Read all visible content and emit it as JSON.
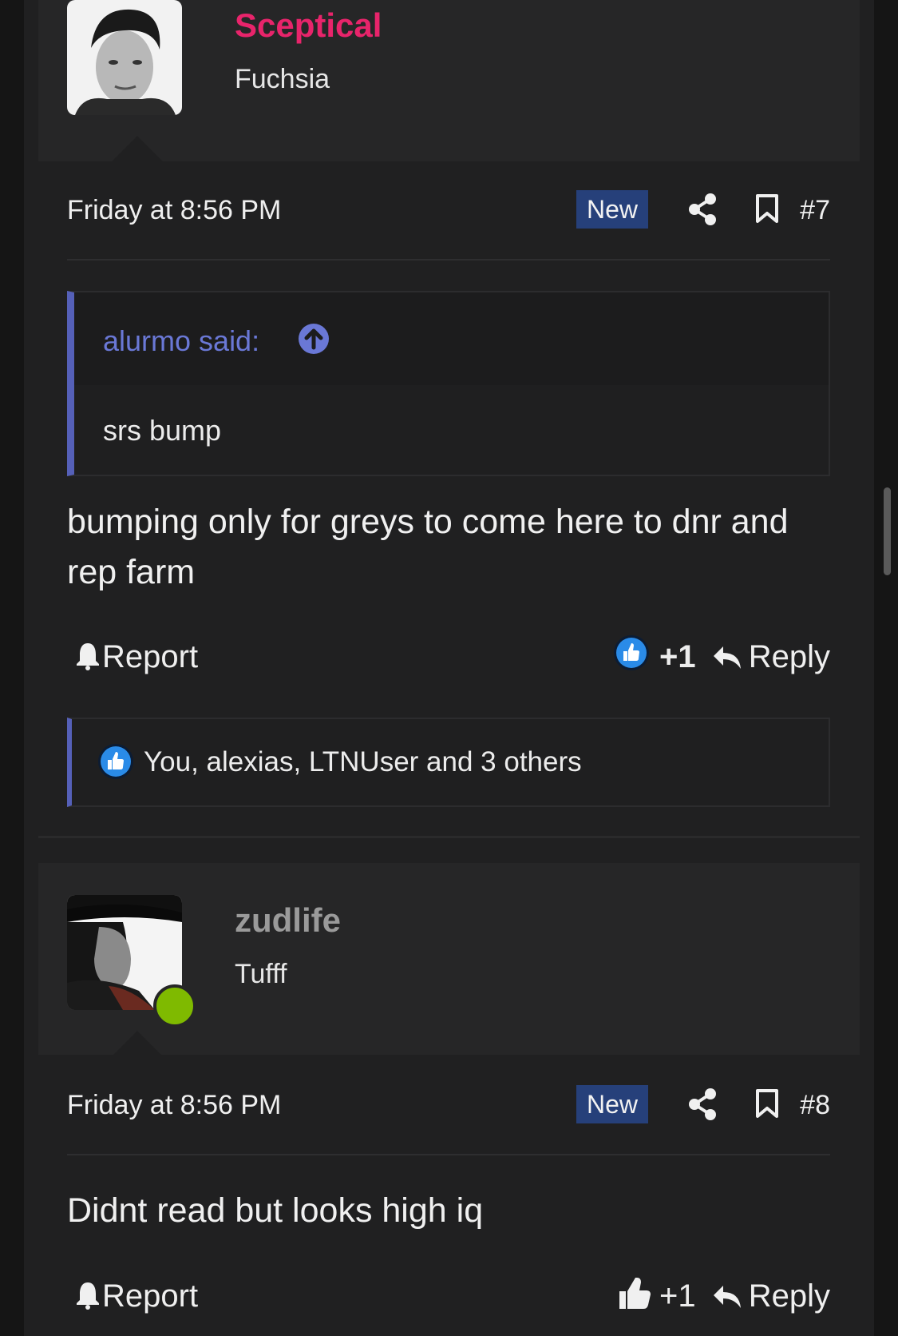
{
  "colors": {
    "accent": "#5560b8",
    "username_pink": "#e8246b",
    "username_gray": "#9a9a9a",
    "new_badge": "#26407a",
    "online": "#7fba00"
  },
  "posts": [
    {
      "username": "Sceptical",
      "user_title": "Fuchsia",
      "date": "Friday at 8:56 PM",
      "badge": "New",
      "number": "#7",
      "quote": {
        "author": "alurmo said:",
        "text": "srs bump"
      },
      "message": "bumping only for greys to come here to dnr and rep farm",
      "report_label": "Report",
      "like_count": "+1",
      "reply_label": "Reply",
      "likes_summary": "You, alexias, LTNUser and 3 others"
    },
    {
      "username": "zudlife",
      "user_title": "Tufff",
      "date": "Friday at 8:56 PM",
      "badge": "New",
      "number": "#8",
      "message": "Didnt read but looks high iq",
      "report_label": "Report",
      "like_count": "+1",
      "reply_label": "Reply"
    }
  ]
}
